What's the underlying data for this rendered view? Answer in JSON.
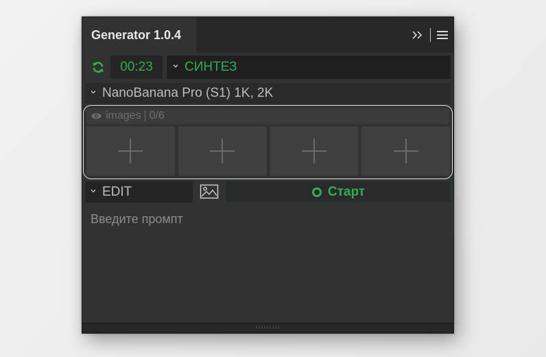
{
  "panel": {
    "title": "Generator 1.0.4"
  },
  "toolbar": {
    "expand_icon": "double-chevron-right-icon",
    "menu_icon": "hamburger-menu-icon"
  },
  "status": {
    "refresh_icon": "refresh-icon",
    "timer": "00:23",
    "mode": "СИНТЕЗ"
  },
  "model": {
    "selected": "NanoBanana Pro (S1) 1K, 2K"
  },
  "images": {
    "label": "images",
    "count": "0/6",
    "slots": [
      {
        "icon": "plus-icon"
      },
      {
        "icon": "plus-icon"
      },
      {
        "icon": "plus-icon"
      },
      {
        "icon": "plus-icon"
      }
    ]
  },
  "action": {
    "edit_mode": "EDIT",
    "image_icon": "image-icon",
    "start_label": "Старт"
  },
  "prompt": {
    "placeholder": "Введите промпт",
    "value": ""
  },
  "colors": {
    "accent_green": "#2fae52",
    "panel_bg": "#323232",
    "tabbar_bg": "#282828",
    "highlight_border": "#e6e6e6"
  }
}
